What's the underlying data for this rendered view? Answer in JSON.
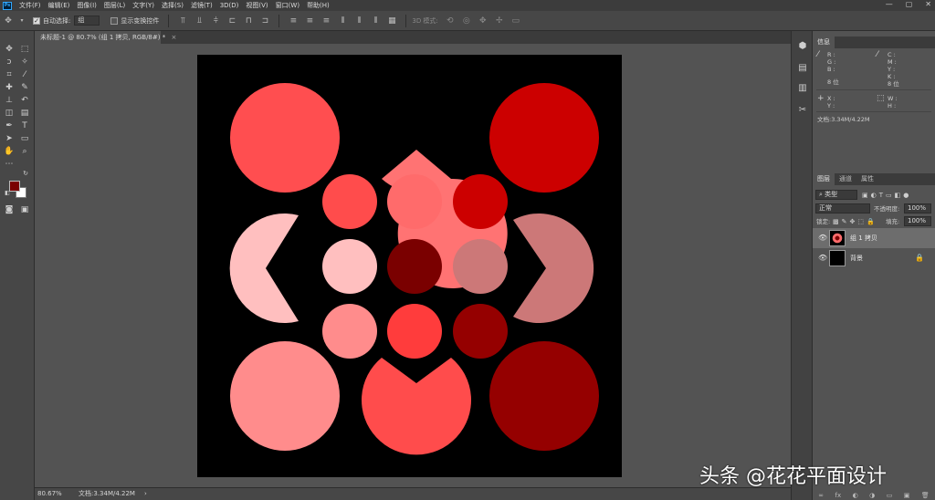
{
  "menu": {
    "logo": "Ps",
    "items": [
      "文件(F)",
      "编辑(E)",
      "图像(I)",
      "图层(L)",
      "文字(Y)",
      "选择(S)",
      "滤镜(T)",
      "3D(D)",
      "视图(V)",
      "窗口(W)",
      "帮助(H)"
    ],
    "window_controls": [
      "—",
      "▢",
      "✕"
    ]
  },
  "options": {
    "auto_select_label": "自动选择:",
    "auto_select_value": "组",
    "show_transform_label": "显示变换控件",
    "mode_3d_label": "3D 模式:"
  },
  "document": {
    "tab_title": "未标题-1 @ 80.7% (组 1 拷贝, RGB/8#) *",
    "tab_close": "×",
    "background": "#000000",
    "shapes": [
      {
        "kind": "circle",
        "name": "circle-top-left",
        "color": "#ff4e50"
      },
      {
        "kind": "pacman",
        "name": "pacman-top-center",
        "color": "#ff7373",
        "mouth": "down"
      },
      {
        "kind": "circle",
        "name": "circle-top-right",
        "color": "#cc0000"
      },
      {
        "kind": "pacman",
        "name": "pacman-mid-left",
        "color": "#ffbfbf",
        "mouth": "right"
      },
      {
        "kind": "pacman",
        "name": "pacman-mid-right",
        "color": "#cc7878",
        "mouth": "left"
      },
      {
        "kind": "circle",
        "name": "circle-bottom-left",
        "color": "#ff8c8c"
      },
      {
        "kind": "pacman",
        "name": "pacman-bottom-center",
        "color": "#ff4c4c",
        "mouth": "up"
      },
      {
        "kind": "circle",
        "name": "circle-bottom-right",
        "color": "#950000"
      },
      {
        "kind": "circle",
        "name": "small-circle-1",
        "color": "#ff4c4c"
      },
      {
        "kind": "circle",
        "name": "small-circle-2",
        "color": "#ff6b6b"
      },
      {
        "kind": "circle",
        "name": "small-circle-3",
        "color": "#cc0000"
      },
      {
        "kind": "circle",
        "name": "small-circle-4",
        "color": "#ffbfbf"
      },
      {
        "kind": "circle",
        "name": "small-circle-5",
        "color": "#7a0000"
      },
      {
        "kind": "circle",
        "name": "small-circle-6",
        "color": "#cc7878"
      },
      {
        "kind": "circle",
        "name": "small-circle-7",
        "color": "#ff8c8c"
      },
      {
        "kind": "circle",
        "name": "small-circle-8",
        "color": "#ff3c3c"
      },
      {
        "kind": "circle",
        "name": "small-circle-9",
        "color": "#950000"
      }
    ]
  },
  "colors": {
    "foreground": "#7a0000",
    "background": "#ffffff"
  },
  "info_panel": {
    "tab": "信息",
    "rgb_labels": "R :\nG :\nB :",
    "cmyk_labels": "C :\nM :\nY :\nK :",
    "bit_left": "8 位",
    "bit_right": "8 位",
    "xy_labels": "X :\nY :",
    "wh_labels": "W :\nH :",
    "doc_size": "文档:3.34M/4.22M"
  },
  "layers_panel": {
    "tabs": [
      "图层",
      "通道",
      "属性"
    ],
    "filter_type": "类型",
    "blend_mode": "正常",
    "opacity_label": "不透明度:",
    "opacity_value": "100%",
    "lock_label": "锁定:",
    "fill_label": "填充:",
    "fill_value": "100%",
    "layers": [
      {
        "name": "组 1 拷贝",
        "selected": true
      },
      {
        "name": "背景",
        "selected": false,
        "locked": true
      }
    ],
    "bottom_icons": [
      "∞",
      "fx",
      "◐",
      "◑",
      "▭",
      "▣",
      "🗑"
    ]
  },
  "status": {
    "zoom": "80.67%",
    "doc_size": "文档:3.34M/4.22M",
    "arrow": "›"
  },
  "watermark": "头条 @花花平面设计"
}
